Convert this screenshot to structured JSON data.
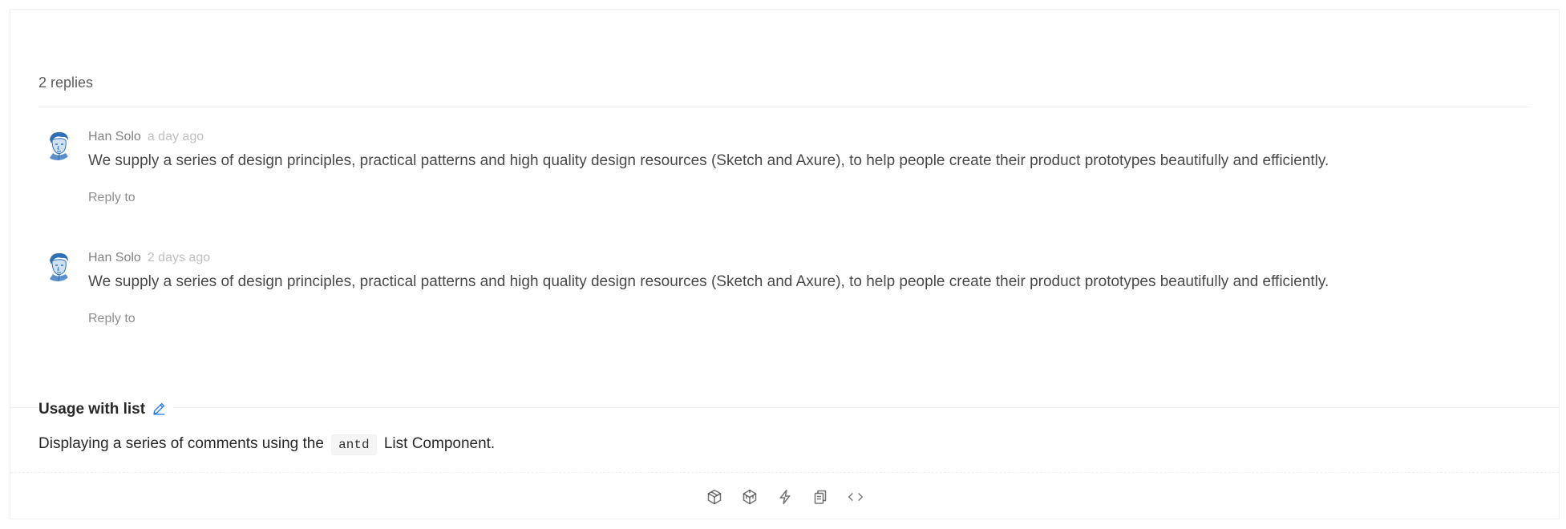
{
  "comments": {
    "reply_count": "2 replies",
    "items": [
      {
        "author": "Han Solo",
        "datetime": "a day ago",
        "content": "We supply a series of design principles, practical patterns and high quality design resources (Sketch and Axure), to help people create their product prototypes beautifully and efficiently.",
        "action": "Reply to"
      },
      {
        "author": "Han Solo",
        "datetime": "2 days ago",
        "content": "We supply a series of design principles, practical patterns and high quality design resources (Sketch and Axure), to help people create their product prototypes beautifully and efficiently.",
        "action": "Reply to"
      }
    ]
  },
  "meta": {
    "title": "Usage with list",
    "description_before": "Displaying a series of comments using the",
    "code": "antd",
    "description_after": "List Component."
  },
  "actions": {
    "icons": [
      "codesandbox-icon",
      "codepen-icon",
      "stackblitz-icon",
      "copy-icon",
      "code-expand-icon"
    ]
  },
  "colors": {
    "avatar_blue": "#2f6fb5",
    "border": "#f0f0f0"
  }
}
